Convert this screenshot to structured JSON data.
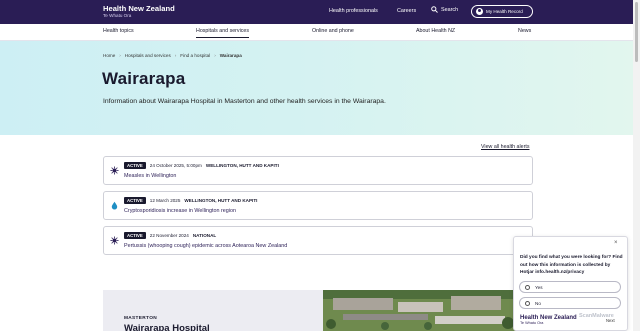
{
  "topbar": {
    "logo_main": "Health New Zealand",
    "logo_sub": "Te Whatu Ora",
    "links": [
      {
        "label": "Health professionals"
      },
      {
        "label": "Careers"
      }
    ],
    "search_label": "Search",
    "mhr_label": "My Health Record",
    "bg_color": "#2a1d55"
  },
  "nav": {
    "items": [
      {
        "label": "Health topics"
      },
      {
        "label": "Hospitals and services"
      },
      {
        "label": "Online and phone"
      },
      {
        "label": "About Health NZ"
      },
      {
        "label": "News"
      }
    ]
  },
  "breadcrumb": [
    {
      "label": "Home"
    },
    {
      "label": "Hospitals and services"
    },
    {
      "label": "Find a hospital"
    },
    {
      "label": "Wairarapa"
    }
  ],
  "hero": {
    "title": "Wairarapa",
    "description": "Information about Wairarapa Hospital in Masterton and other health services in the Wairarapa."
  },
  "alerts": {
    "view_all_label": "View all health alerts",
    "items": [
      {
        "icon": "virus-icon",
        "status": "ACTIVE",
        "date": "24 October 2025, 5:00pm",
        "region": "WELLINGTON, HUTT AND KAPITI",
        "title": "Measles in Wellington"
      },
      {
        "icon": "water-drop-icon",
        "status": "ACTIVE",
        "date": "12 March 2025",
        "region": "WELLINGTON, HUTT AND KAPITI",
        "title": "Cryptosporidiosis increase in Wellington region"
      },
      {
        "icon": "virus-icon",
        "status": "ACTIVE",
        "date": "22 November 2024",
        "region": "NATIONAL",
        "title": "Pertussis (whooping cough) epidemic across Aotearoa New Zealand"
      }
    ]
  },
  "location_card": {
    "label": "MASTERTON",
    "title": "Wairarapa Hospital"
  },
  "survey": {
    "question": "Did you find what you were looking for? Find out how this information is collected by Hotjar info.health.nz/privacy",
    "options": [
      {
        "label": "Yes"
      },
      {
        "label": "No"
      }
    ],
    "footer_main": "Health New Zealand",
    "footer_sub": "Te Whatu Ora",
    "next_label": "Next",
    "watermark": "ScanMalware"
  }
}
